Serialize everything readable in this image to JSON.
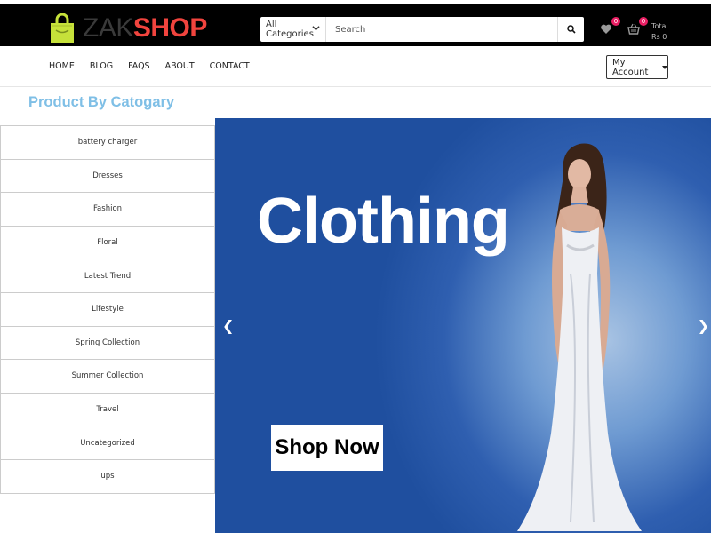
{
  "brand": {
    "part1": "ZAK",
    "part2": "SHOP"
  },
  "search": {
    "category": "All Categories",
    "placeholder": "Search"
  },
  "header": {
    "wishlist_count": "0",
    "cart_count": "0",
    "total_label": "Total",
    "total_value": "Rs 0"
  },
  "nav": {
    "links": [
      "HOME",
      "BLOG",
      "FAQS",
      "ABOUT",
      "CONTACT"
    ],
    "account_label": "My Account"
  },
  "sidebar": {
    "heading": "Product By Catogary",
    "categories": [
      "battery charger",
      "Dresses",
      "Fashion",
      "Floral",
      "Latest Trend",
      "Lifestyle",
      "Spring Collection",
      "Summer Collection",
      "Travel",
      "Uncategorized",
      "ups"
    ]
  },
  "banner": {
    "title": "Clothing",
    "cta": "Shop Now",
    "prev": "❮",
    "next": "❯"
  },
  "icons": {
    "bag": "shopping-bag-icon",
    "search": "search-icon",
    "heart": "heart-icon",
    "cart": "cart-icon"
  },
  "colors": {
    "accent": "#f1443e",
    "logo_bag": "#c6e13a",
    "heading": "#7fbfe6",
    "badge": "#e91e63",
    "banner_blue": "#2f5fb0"
  }
}
